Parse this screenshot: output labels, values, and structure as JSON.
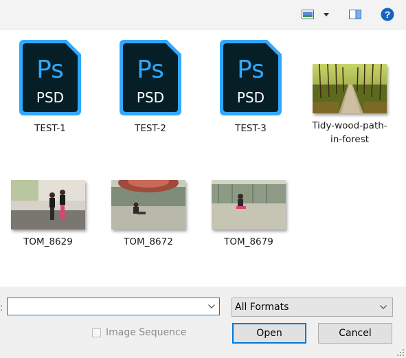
{
  "toolbar": {
    "icons": [
      "preview-pane-icon",
      "dropdown-arrow-icon",
      "view-toggle-icon",
      "help-icon"
    ],
    "help_label": "?"
  },
  "files": [
    {
      "name": "TEST-1",
      "type": "psd",
      "icon_text_top": "Ps",
      "icon_text_bottom": "PSD"
    },
    {
      "name": "TEST-2",
      "type": "psd",
      "icon_text_top": "Ps",
      "icon_text_bottom": "PSD"
    },
    {
      "name": "TEST-3",
      "type": "psd",
      "icon_text_top": "Ps",
      "icon_text_bottom": "PSD"
    },
    {
      "name_line1": "Tidy-wood-path-",
      "name_line2": "in-forest",
      "type": "image"
    },
    {
      "name": "TOM_8629",
      "type": "image"
    },
    {
      "name": "TOM_8672",
      "type": "image"
    },
    {
      "name": "TOM_8679",
      "type": "image"
    }
  ],
  "bottom": {
    "filename_label": ":",
    "filename_value": "",
    "format_selected": "All Formats",
    "image_sequence_label": "Image Sequence",
    "image_sequence_checked": false,
    "open_label": "Open",
    "cancel_label": "Cancel"
  },
  "colors": {
    "psd_bg": "#061e26",
    "psd_accent": "#31a8ff",
    "accent": "#0078d7"
  }
}
